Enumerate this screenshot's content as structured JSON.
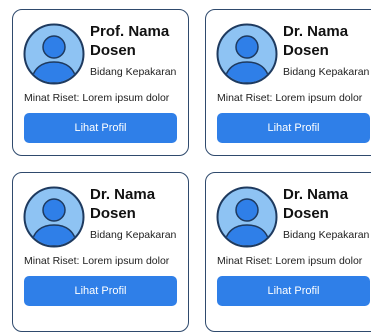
{
  "cards": [
    {
      "name_line1": "Prof. Nama",
      "name_line2": "Dosen",
      "expertise": "Bidang Kepakaran",
      "interest": "Minat Riset: Lorem ipsum dolor",
      "button": "Lihat Profil"
    },
    {
      "name_line1": "Dr. Nama",
      "name_line2": "Dosen",
      "expertise": "Bidang Kepakaran",
      "interest": "Minat Riset: Lorem ipsum dolor",
      "button": "Lihat Profil"
    },
    {
      "name_line1": "Dr. Nama",
      "name_line2": "Dosen",
      "expertise": "Bidang Kepakaran",
      "interest": "Minat Riset: Lorem ipsum dolor",
      "button": "Lihat Profil"
    },
    {
      "name_line1": "Dr. Nama",
      "name_line2": "Dosen",
      "expertise": "Bidang Kepakaran",
      "interest": "Minat Riset: Lorem ipsum dolor",
      "button": "Lihat Profil"
    }
  ],
  "colors": {
    "accent": "#2f7fe8",
    "card_border": "#2f4a6d",
    "avatar_bg": "#8ec3f3",
    "avatar_fg": "#2f7fe8"
  },
  "icons": {
    "avatar": "user-avatar-icon"
  }
}
